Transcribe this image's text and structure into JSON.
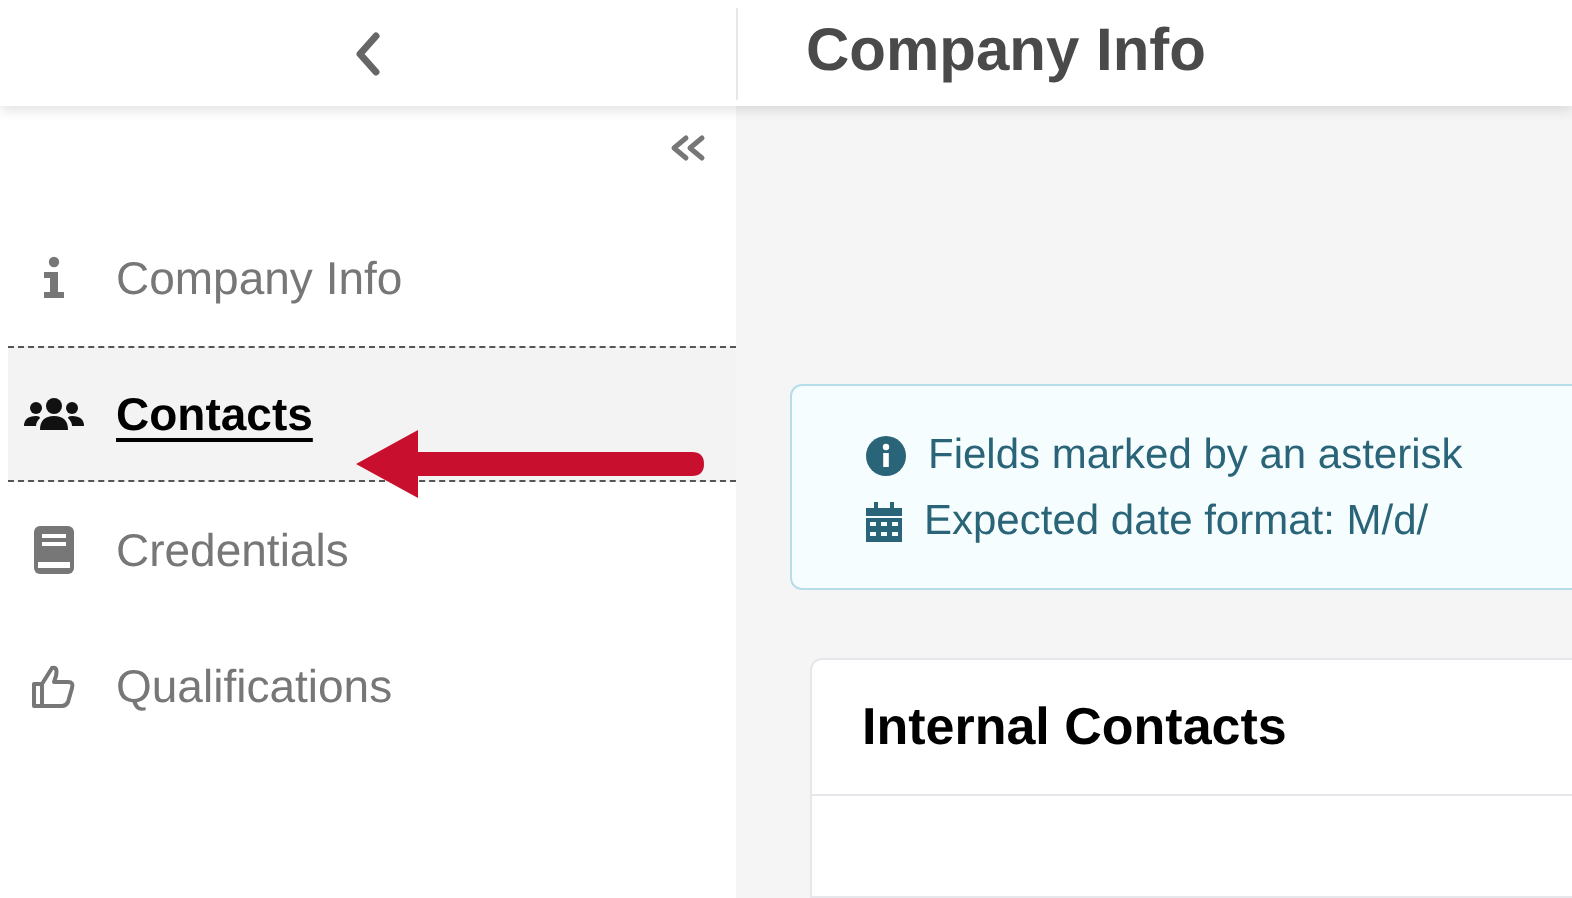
{
  "header": {
    "title": "Company Info"
  },
  "sidebar": {
    "items": [
      {
        "label": "Company Info",
        "selected": false
      },
      {
        "label": "Contacts",
        "selected": true
      },
      {
        "label": "Credentials",
        "selected": false
      },
      {
        "label": "Qualifications",
        "selected": false
      }
    ]
  },
  "notice": {
    "lines": [
      "Fields marked by an asterisk",
      "Expected date format: M/d/"
    ]
  },
  "card": {
    "title": "Internal Contacts"
  }
}
